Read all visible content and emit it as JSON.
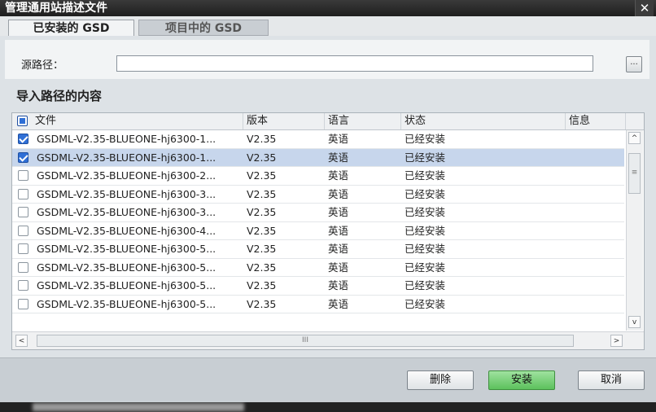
{
  "window": {
    "title": "管理通用站描述文件",
    "close_glyph": "✕"
  },
  "tabs": [
    {
      "label": "已安装的 GSD",
      "active": true
    },
    {
      "label": "项目中的 GSD",
      "active": false
    }
  ],
  "source": {
    "label": "源路径：",
    "browse_label": "..."
  },
  "section": {
    "title": "导入路径的内容"
  },
  "table": {
    "columns": [
      "文件",
      "版本",
      "语言",
      "状态",
      "信息"
    ],
    "rows": [
      {
        "file": "GSDML-V2.35-BLUEONE-hj6300-1...",
        "version": "V2.35",
        "language": "英语",
        "status": "已经安装",
        "info": "",
        "checked": true,
        "selected": false
      },
      {
        "file": "GSDML-V2.35-BLUEONE-hj6300-1...",
        "version": "V2.35",
        "language": "英语",
        "status": "已经安装",
        "info": "",
        "checked": true,
        "selected": true
      },
      {
        "file": "GSDML-V2.35-BLUEONE-hj6300-2...",
        "version": "V2.35",
        "language": "英语",
        "status": "已经安装",
        "info": "",
        "checked": false,
        "selected": false
      },
      {
        "file": "GSDML-V2.35-BLUEONE-hj6300-3...",
        "version": "V2.35",
        "language": "英语",
        "status": "已经安装",
        "info": "",
        "checked": false,
        "selected": false
      },
      {
        "file": "GSDML-V2.35-BLUEONE-hj6300-3...",
        "version": "V2.35",
        "language": "英语",
        "status": "已经安装",
        "info": "",
        "checked": false,
        "selected": false
      },
      {
        "file": "GSDML-V2.35-BLUEONE-hj6300-4...",
        "version": "V2.35",
        "language": "英语",
        "status": "已经安装",
        "info": "",
        "checked": false,
        "selected": false
      },
      {
        "file": "GSDML-V2.35-BLUEONE-hj6300-5...",
        "version": "V2.35",
        "language": "英语",
        "status": "已经安装",
        "info": "",
        "checked": false,
        "selected": false
      },
      {
        "file": "GSDML-V2.35-BLUEONE-hj6300-5...",
        "version": "V2.35",
        "language": "英语",
        "status": "已经安装",
        "info": "",
        "checked": false,
        "selected": false
      },
      {
        "file": "GSDML-V2.35-BLUEONE-hj6300-5...",
        "version": "V2.35",
        "language": "英语",
        "status": "已经安装",
        "info": "",
        "checked": false,
        "selected": false
      },
      {
        "file": "GSDML-V2.35-BLUEONE-hj6300-5...",
        "version": "V2.35",
        "language": "英语",
        "status": "已经安装",
        "info": "",
        "checked": false,
        "selected": false
      }
    ]
  },
  "scrollbars": {
    "up": "^",
    "down": "v",
    "left": "<",
    "right": ">",
    "v_grip": "≡",
    "h_grip": "III"
  },
  "buttons": {
    "delete": "删除",
    "install": "安装",
    "cancel": "取消"
  }
}
